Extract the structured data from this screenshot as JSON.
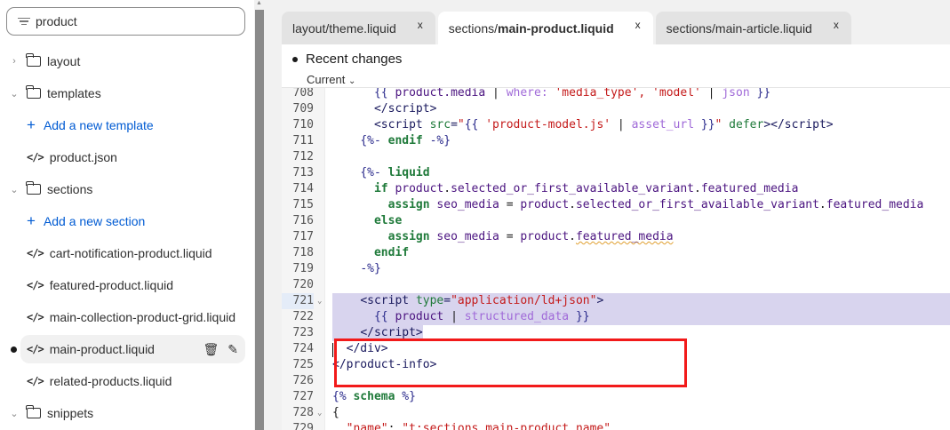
{
  "sidebar": {
    "search_value": "product",
    "items": [
      {
        "type": "folder",
        "label": "layout",
        "expanded": false
      },
      {
        "type": "folder",
        "label": "templates",
        "expanded": true
      },
      {
        "type": "add",
        "label": "Add a new template"
      },
      {
        "type": "file",
        "label": "product.json"
      },
      {
        "type": "folder",
        "label": "sections",
        "expanded": true
      },
      {
        "type": "add",
        "label": "Add a new section"
      },
      {
        "type": "file",
        "label": "cart-notification-product.liquid"
      },
      {
        "type": "file",
        "label": "featured-product.liquid"
      },
      {
        "type": "file",
        "label": "main-collection-product-grid.liquid"
      },
      {
        "type": "file",
        "label": "main-product.liquid",
        "selected": true,
        "modified": true
      },
      {
        "type": "file",
        "label": "related-products.liquid"
      },
      {
        "type": "folder",
        "label": "snippets",
        "expanded": true
      }
    ]
  },
  "tabs": [
    {
      "prefix": "layout/theme.liquid",
      "bold": "",
      "active": false
    },
    {
      "prefix": "sections/",
      "bold": "main-product.liquid",
      "active": true
    },
    {
      "prefix": "sections/main-article.liquid",
      "bold": "",
      "active": false
    }
  ],
  "editor": {
    "recent_changes": "Recent changes",
    "version_select": "Current",
    "lines": [
      {
        "n": "708",
        "t": [
          [
            "plain",
            "      "
          ],
          [
            "delim",
            "{{ "
          ],
          [
            "var",
            "product.media"
          ],
          [
            "plain",
            " | "
          ],
          [
            "filt",
            "where: "
          ],
          [
            "str",
            "'media_type', 'model'"
          ],
          [
            "plain",
            " | "
          ],
          [
            "filt",
            "json"
          ],
          [
            "delim",
            " }}"
          ]
        ]
      },
      {
        "n": "709",
        "t": [
          [
            "plain",
            "      "
          ],
          [
            "tag",
            "</script>"
          ]
        ]
      },
      {
        "n": "710",
        "t": [
          [
            "plain",
            "      "
          ],
          [
            "tag",
            "<script "
          ],
          [
            "attr",
            "src"
          ],
          [
            "tag",
            "="
          ],
          [
            "str",
            "\""
          ],
          [
            "delim",
            "{{ "
          ],
          [
            "str",
            "'product-model.js'"
          ],
          [
            "plain",
            " | "
          ],
          [
            "filt",
            "asset_url"
          ],
          [
            "delim",
            " }}"
          ],
          [
            "str",
            "\""
          ],
          [
            "attr",
            " defer"
          ],
          [
            "tag",
            "></script>"
          ]
        ]
      },
      {
        "n": "711",
        "t": [
          [
            "plain",
            "    "
          ],
          [
            "delim",
            "{%- "
          ],
          [
            "kw",
            "endif"
          ],
          [
            "delim",
            " -%}"
          ]
        ]
      },
      {
        "n": "712",
        "t": []
      },
      {
        "n": "713",
        "t": [
          [
            "plain",
            "    "
          ],
          [
            "delim",
            "{%- "
          ],
          [
            "kw",
            "liquid"
          ]
        ]
      },
      {
        "n": "714",
        "t": [
          [
            "plain",
            "      "
          ],
          [
            "kw",
            "if "
          ],
          [
            "var",
            "product"
          ],
          [
            "plain",
            "."
          ],
          [
            "var",
            "selected_or_first_available_variant"
          ],
          [
            "plain",
            "."
          ],
          [
            "var",
            "featured_media"
          ]
        ]
      },
      {
        "n": "715",
        "t": [
          [
            "plain",
            "        "
          ],
          [
            "kw",
            "assign "
          ],
          [
            "var",
            "seo_media"
          ],
          [
            "plain",
            " = "
          ],
          [
            "var",
            "product"
          ],
          [
            "plain",
            "."
          ],
          [
            "var",
            "selected_or_first_available_variant"
          ],
          [
            "plain",
            "."
          ],
          [
            "var",
            "featured_media"
          ]
        ]
      },
      {
        "n": "716",
        "t": [
          [
            "plain",
            "      "
          ],
          [
            "kw",
            "else"
          ]
        ]
      },
      {
        "n": "717",
        "t": [
          [
            "plain",
            "        "
          ],
          [
            "kw",
            "assign "
          ],
          [
            "var",
            "seo_media"
          ],
          [
            "plain",
            " = "
          ],
          [
            "var",
            "product"
          ],
          [
            "plain",
            "."
          ],
          [
            "squig",
            "featured_media"
          ]
        ]
      },
      {
        "n": "718",
        "t": [
          [
            "plain",
            "      "
          ],
          [
            "kw",
            "endif"
          ]
        ]
      },
      {
        "n": "719",
        "t": [
          [
            "plain",
            "    "
          ],
          [
            "delim",
            "-%}"
          ]
        ]
      },
      {
        "n": "720",
        "t": []
      },
      {
        "n": "721",
        "fold": true,
        "hl": "first",
        "t": [
          [
            "plain",
            "    "
          ],
          [
            "tag",
            "<script "
          ],
          [
            "attr",
            "type"
          ],
          [
            "tag",
            "="
          ],
          [
            "str",
            "\"application/ld+json\""
          ],
          [
            "tag",
            ">"
          ]
        ]
      },
      {
        "n": "722",
        "hl": "mid",
        "t": [
          [
            "plain",
            "      "
          ],
          [
            "delim",
            "{{ "
          ],
          [
            "var",
            "product"
          ],
          [
            "plain",
            " | "
          ],
          [
            "filt",
            "structured_data"
          ],
          [
            "delim",
            " }}"
          ]
        ]
      },
      {
        "n": "723",
        "hl": "last",
        "t": [
          [
            "plain",
            "    "
          ],
          [
            "tag",
            "</script>"
          ]
        ]
      },
      {
        "n": "724",
        "t": [
          [
            "plain",
            "  "
          ],
          [
            "tag",
            "</div>"
          ]
        ]
      },
      {
        "n": "725",
        "t": [
          [
            "tag",
            "</product-info>"
          ]
        ]
      },
      {
        "n": "726",
        "t": []
      },
      {
        "n": "727",
        "t": [
          [
            "delim",
            "{% "
          ],
          [
            "kw",
            "schema"
          ],
          [
            "delim",
            " %}"
          ]
        ]
      },
      {
        "n": "728",
        "fold": true,
        "t": [
          [
            "plain",
            "{"
          ]
        ]
      },
      {
        "n": "729",
        "t": [
          [
            "plain",
            "  "
          ],
          [
            "str",
            "\"name\""
          ],
          [
            "plain",
            ": "
          ],
          [
            "str",
            "\"t:sections.main-product.name\""
          ],
          [
            "plain",
            ","
          ]
        ]
      }
    ]
  }
}
